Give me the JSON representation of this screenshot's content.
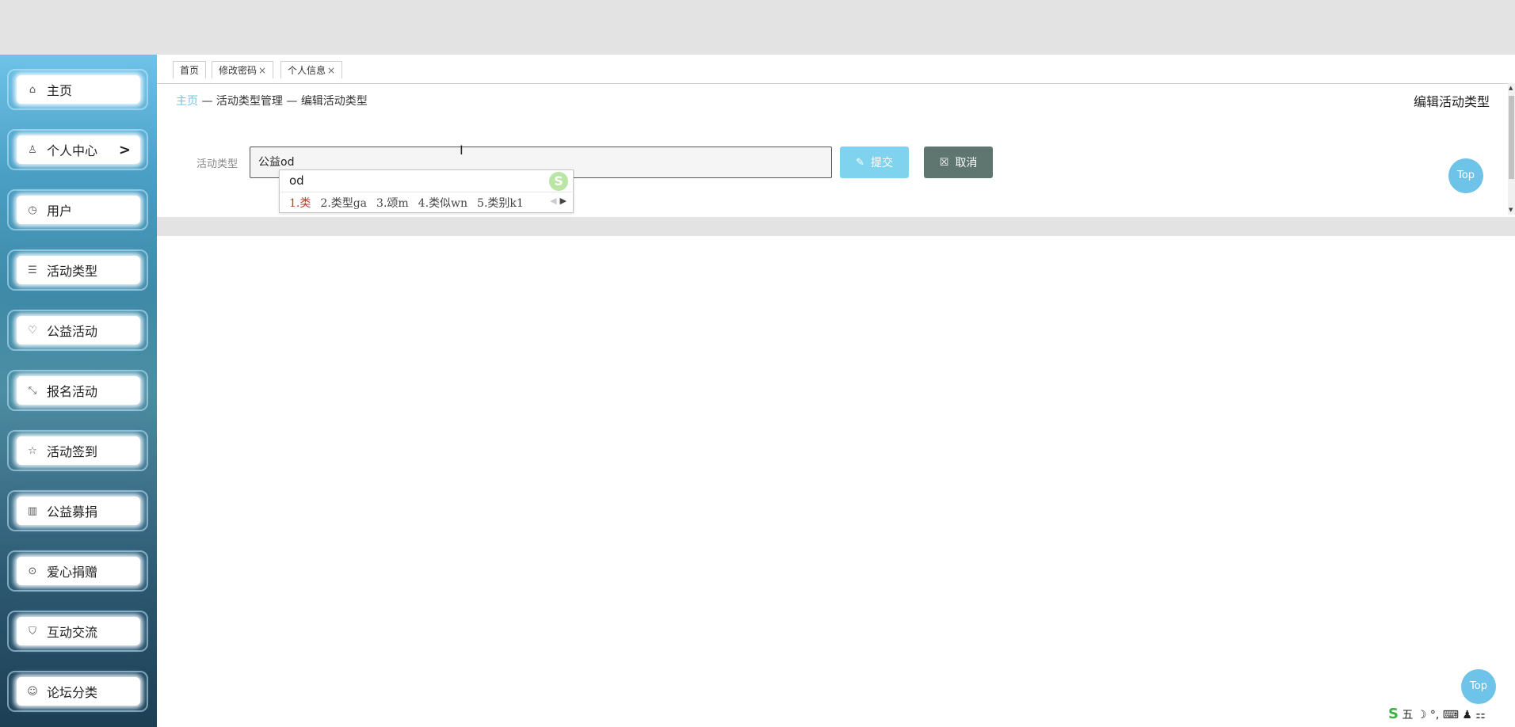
{
  "colors": {
    "accent": "#6ec3e8",
    "submit_button": "#7fd3ef",
    "cancel_button": "#5e7570",
    "ime_selected": "#c0392b"
  },
  "sidebar": {
    "items": [
      {
        "label": "主页",
        "icon": "home-icon"
      },
      {
        "label": "个人中心",
        "icon": "user-icon",
        "has_arrow": true
      },
      {
        "label": "用户",
        "icon": "clock-icon"
      },
      {
        "label": "活动类型",
        "icon": "list-icon"
      },
      {
        "label": "公益活动",
        "icon": "heart-icon"
      },
      {
        "label": "报名活动",
        "icon": "shrink-icon"
      },
      {
        "label": "活动签到",
        "icon": "star-icon"
      },
      {
        "label": "公益募捐",
        "icon": "chart-icon"
      },
      {
        "label": "爱心捐赠",
        "icon": "target-icon"
      },
      {
        "label": "互动交流",
        "icon": "shield-icon"
      },
      {
        "label": "论坛分类",
        "icon": "chat-icon"
      }
    ],
    "arrow": ">"
  },
  "tabs": [
    {
      "label": "首页",
      "closable": false
    },
    {
      "label": "修改密码",
      "closable": true
    },
    {
      "label": "个人信息",
      "closable": true
    }
  ],
  "tab_close": "×",
  "breadcrumb": {
    "home": "主页",
    "sep": " — ",
    "section": "活动类型管理",
    "current": "编辑活动类型"
  },
  "page_title": "编辑活动类型",
  "form": {
    "label": "活动类型",
    "value": "公益od",
    "submit": "提交",
    "cancel": "取消"
  },
  "ime": {
    "composition": "od",
    "logo": "S",
    "candidates": [
      "1.类",
      "2.类型ga",
      "3.颂m",
      "4.类似wn",
      "5.类别k1"
    ],
    "selected_index": 0
  },
  "top_button": "Top",
  "tray": {
    "logo": "S",
    "text": "五 ☽ °, ⌨ ♟ ⚏"
  }
}
